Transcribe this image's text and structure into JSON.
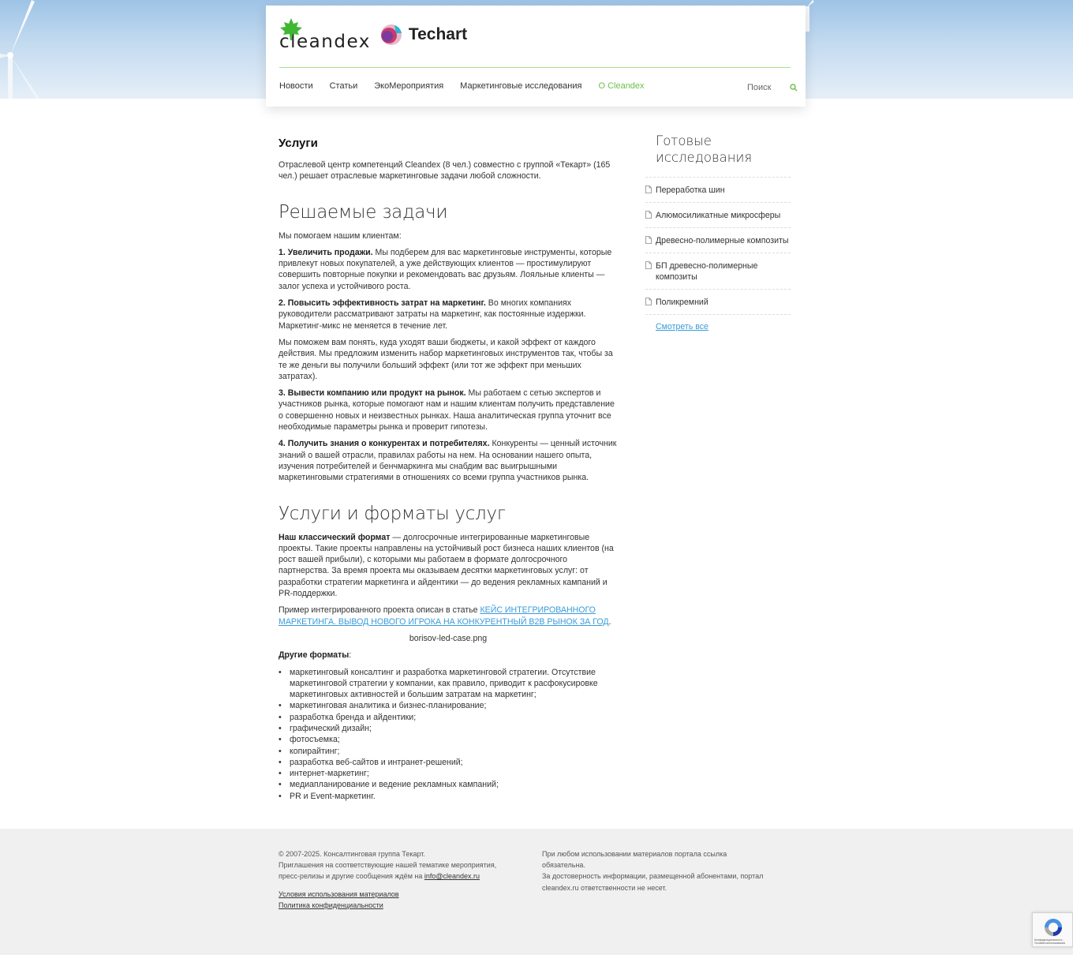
{
  "header": {
    "logo_cleandex": "cleandex",
    "logo_techart": "Techart",
    "nav": [
      {
        "label": "Новости"
      },
      {
        "label": "Статьи"
      },
      {
        "label": "ЭкоМероприятия"
      },
      {
        "label": "Маркетинговые исследования"
      },
      {
        "label": "О Cleandex"
      }
    ],
    "search_label": "Поиск"
  },
  "main": {
    "title": "Услуги",
    "intro": "Отраслевой центр компетенций Cleandex (8 чел.) совместно с группой «Текарт» (165 чел.) решает отраслевые маркетинговые задачи любой сложности.",
    "section1_title": "Решаемые задачи",
    "section1_lead": "Мы помогаем нашим клиентам:",
    "task1_bold": "1. Увеличить продажи.",
    "task1_text": " Мы подберем для вас маркетинговые инструменты, которые привлекут новых покупателей, а уже действующих клиентов — простимулируют совершить повторные покупки и рекомендовать вас друзьям. Лояльные клиенты — залог успеха и устойчивого роста.",
    "task2_bold": "2. Повысить эффективность затрат на маркетинг.",
    "task2_text": " Во многих компаниях руководители рассматривают затраты на маркетинг, как постоянные издержки. Маркетинг-микс не меняется в течение лет.",
    "task2_extra": "Мы поможем вам понять, куда уходят ваши бюджеты, и какой эффект от каждого действия. Мы предложим изменить набор маркетинговых инструментов так, чтобы за те же деньги вы получили больший эффект (или тот же эффект при меньших затратах).",
    "task3_bold": "3. Вывести компанию или продукт на рынок.",
    "task3_text": " Мы работаем с сетью экспертов и участников рынка, которые помогают нам и нашим клиентам получить представление о совершенно новых и неизвестных рынках. Наша аналитическая группа уточнит все необходимые параметры рынка и проверит гипотезы.",
    "task4_bold": "4. Получить знания о конкурентах и потребителях.",
    "task4_text": " Конкуренты — ценный источник знаний о вашей отрасли, правилах работы на нем. На основании нашего опыта, изучения потребителей и бенчмаркинга мы снабдим вас выигрышными маркетинговыми стратегиями в отношениях со всеми группа участников рынка.",
    "section2_title": "Услуги и форматы услуг",
    "classic_bold": "Наш классический формат",
    "classic_text": " — долгосрочные интегрированные маркетинговые проекты. Такие проекты направлены на устойчивый рост бизнеса наших клиентов (на рост вашей прибыли), с которыми мы работаем в формате долгосрочного партнерства. За время проекта мы оказываем десятки маркетинговых услуг: от разработки стратегии маркетинга и айдентики — до ведения рекламных кампаний и PR-поддержки.",
    "example_text": "Пример интегрированного проекта описан в статье ",
    "example_link": "КЕЙС ИНТЕГРИРОВАННОГО МАРКЕТИНГА. ВЫВОД НОВОГО ИГРОКА НА КОНКУРЕНТНЫЙ B2B РЫНОК ЗА ГОД",
    "example_end": ".",
    "image_alt": "borisov-led-case.png",
    "other_bold": "Другие форматы",
    "other_colon": ":",
    "formats": [
      "маркетинговый консалтинг и разработка маркетинговой стратегии. Отсутствие маркетинговой стратегии у компании, как правило, приводит к расфокусировке маркетинговых активностей и большим затратам на маркетинг;",
      "маркетинговая аналитика и бизнес-планирование;",
      "разработка бренда и айдентики;",
      "графический дизайн;",
      "фотосъемка;",
      "копирайтинг;",
      "разработка веб-сайтов и интранет-решений;",
      "интернет-маркетинг;",
      "медиапланирование и ведение рекламных кампаний;",
      "PR и Event-маркетинг."
    ]
  },
  "sidebar": {
    "title": "Готовые исследования",
    "items": [
      {
        "label": "Переработка шин"
      },
      {
        "label": "Алюмосиликатные микросферы"
      },
      {
        "label": "Древесно-полимерные композиты"
      },
      {
        "label": "БП древесно-полимерные композиты"
      },
      {
        "label": "Поликремний"
      }
    ],
    "see_all": "Смотреть все"
  },
  "footer": {
    "copyright": "© 2007-2025. Консалтинговая группа Текарт.",
    "invite_text": "Приглашения на соответствующие нашей тематике мероприятия, пресс-релизы и другие сообщения ждём на ",
    "email": "info@cleandex.ru",
    "terms_link": "Условия использования материалов",
    "privacy_link": "Политика конфиденциальности",
    "notice_1": "При любом использовании материалов портала ссылка обязательна.",
    "notice_2": "За достоверность информации, размещенной абонентами, портал cleandex.ru ответственности не несет.",
    "recaptcha_label": "Конфиденциальность - Условия использования"
  },
  "colors": {
    "accent_green": "#6cc04a",
    "link_blue": "#3a9bd9"
  }
}
